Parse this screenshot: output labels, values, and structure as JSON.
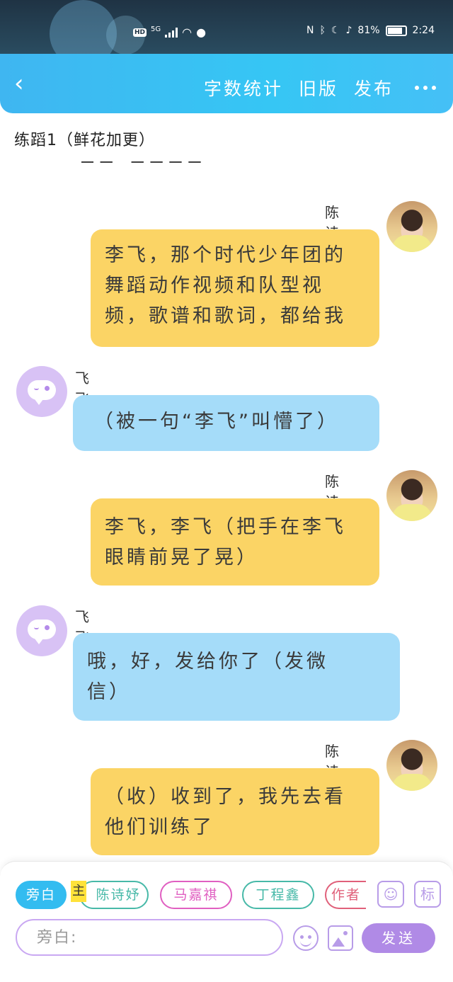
{
  "status_bar": {
    "network_badge": "HD",
    "network_type": "5G",
    "battery": "81%",
    "time": "2:24"
  },
  "header": {
    "back_icon": "chevron-left-icon",
    "actions": [
      "字数统计",
      "旧版",
      "发布"
    ],
    "more_icon": "more-dots-icon"
  },
  "title": "练蹈1（鲜花加更）",
  "messages": [
    {
      "speaker": "陈诗妤",
      "side": "right",
      "color": "yellow",
      "lines": [
        "李飞，那个时代少年团的",
        "舞蹈动作视频和队型视",
        "频，歌谱和歌词，都给我"
      ]
    },
    {
      "speaker": "飞飞子",
      "side": "left",
      "color": "blue",
      "lines": [
        "（被一句“李飞”叫懵了）"
      ]
    },
    {
      "speaker": "陈诗妤",
      "side": "right",
      "color": "yellow",
      "lines": [
        "李飞，李飞（把手在李飞",
        "眼睛前晃了晃）"
      ]
    },
    {
      "speaker": "飞飞子",
      "side": "left",
      "color": "blue",
      "lines": [
        "哦，好，发给你了（发微",
        "信）"
      ]
    },
    {
      "speaker": "陈诗妤",
      "side": "right",
      "color": "yellow",
      "lines": [
        "（收）收到了，我先去看",
        "他们训练了"
      ]
    }
  ],
  "composer": {
    "roles": [
      "旁白",
      "陈诗妤",
      "马嘉祺",
      "丁程鑫",
      "作者"
    ],
    "main_tag": "主",
    "contact_icon": "contact-card-icon",
    "tag_button": "标",
    "input_placeholder": "旁白:",
    "emoji_icon": "smile-icon",
    "image_icon": "image-icon",
    "send_label": "发送"
  },
  "colors": {
    "header": "#3fb6f1",
    "yellow_bubble": "#fbd465",
    "blue_bubble": "#a5dcf9",
    "accent_purple": "#b08ae6"
  }
}
